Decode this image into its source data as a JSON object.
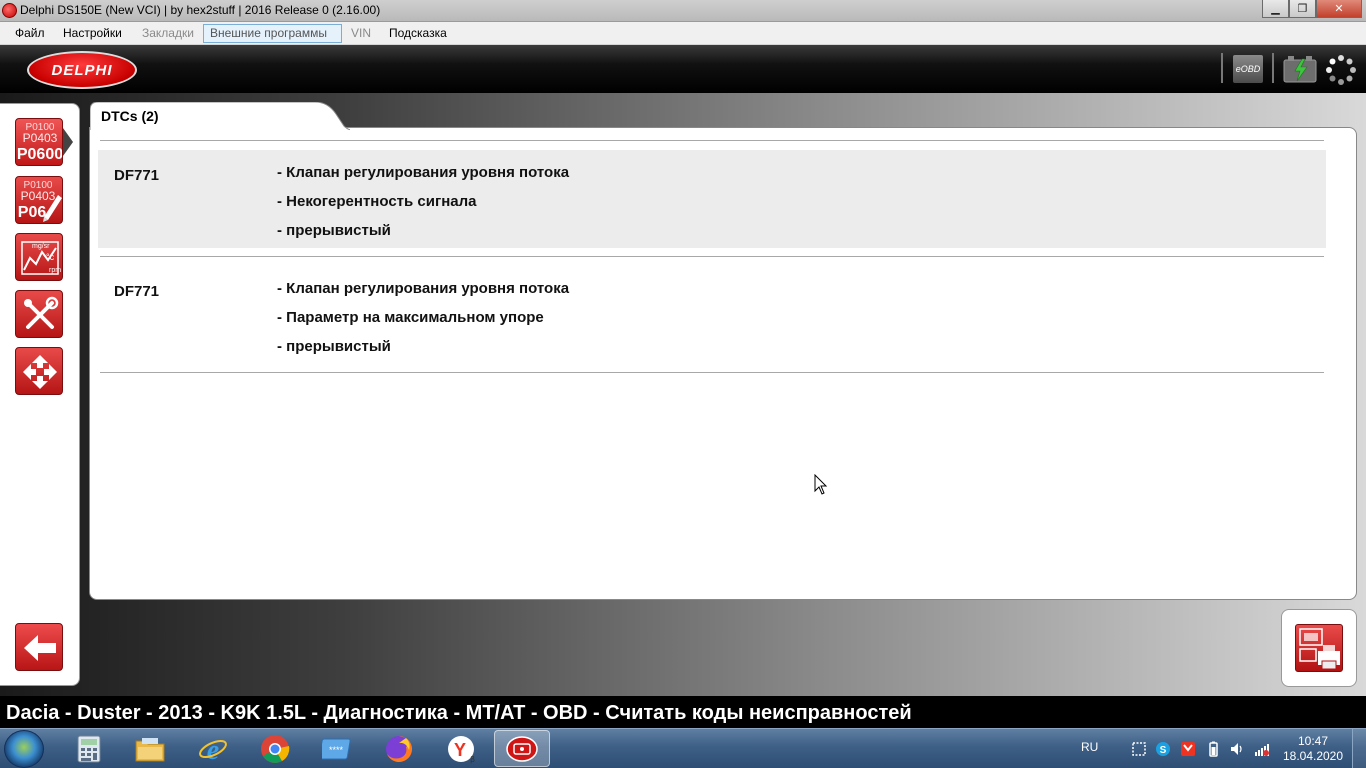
{
  "window": {
    "title": "Delphi DS150E (New VCI) | by hex2stuff | 2016 Release 0 (2.16.00)",
    "controls": [
      "minimize",
      "maximize",
      "close"
    ]
  },
  "menu": {
    "items": [
      {
        "label": "Файл",
        "state": "enabled"
      },
      {
        "label": "Настройки",
        "state": "enabled"
      },
      {
        "label": "Закладки",
        "state": "disabled"
      },
      {
        "label": "Внешние программы",
        "state": "active"
      },
      {
        "label": "VIN",
        "state": "disabled"
      },
      {
        "label": "Подсказка",
        "state": "enabled"
      }
    ]
  },
  "header": {
    "logo_text": "DELPHI",
    "eobd_label": "eOBD",
    "icons": [
      "eobd-icon",
      "battery-charge-icon",
      "loading-dots-icon"
    ]
  },
  "sidebar": {
    "items": [
      {
        "name": "read-dtc",
        "icon": "dtc-codes-icon",
        "lines": [
          "P0100",
          "P0403",
          "P0600"
        ],
        "selected": true
      },
      {
        "name": "clear-dtc",
        "icon": "dtc-erase-icon",
        "lines": [
          "P0100",
          "P0403",
          "P06"
        ],
        "selected": false
      },
      {
        "name": "live-data",
        "icon": "live-data-graph-icon",
        "lines": [
          "mg/sr",
          "°c",
          "rpm"
        ],
        "selected": false
      },
      {
        "name": "activation",
        "icon": "tools-icon",
        "lines": [],
        "selected": false
      },
      {
        "name": "adjustments",
        "icon": "cycle-arrows-icon",
        "lines": [],
        "selected": false
      }
    ],
    "back_icon": "back-arrow-icon"
  },
  "main": {
    "tab_label": "DTCs (2)",
    "dtcs": [
      {
        "code": "DF771",
        "lines": [
          "- Клапан регулирования уровня потока",
          "- Некогерентность сигнала",
          "- прерывистый"
        ]
      },
      {
        "code": "DF771",
        "lines": [
          "- Клапан регулирования уровня потока",
          "- Параметр на максимальном упоре",
          "- прерывистый"
        ]
      }
    ],
    "report_button_icon": "report-print-icon"
  },
  "status": {
    "text": "Dacia - Duster - 2013 - K9K 1.5L - Диагностика - MT/AT - OBD - Считать коды неисправностей"
  },
  "taskbar": {
    "apps": [
      "calculator-icon",
      "explorer-icon",
      "internet-explorer-icon",
      "chrome-icon",
      "keyboard-app-icon",
      "firefox-icon",
      "yandex-browser-icon",
      "delphi-app-icon"
    ],
    "lang": "RU",
    "time": "10:47",
    "date": "18.04.2020"
  },
  "colors": {
    "brand_red": "#c80000",
    "row_shade": "#ececec",
    "status_bar": "#000000"
  }
}
